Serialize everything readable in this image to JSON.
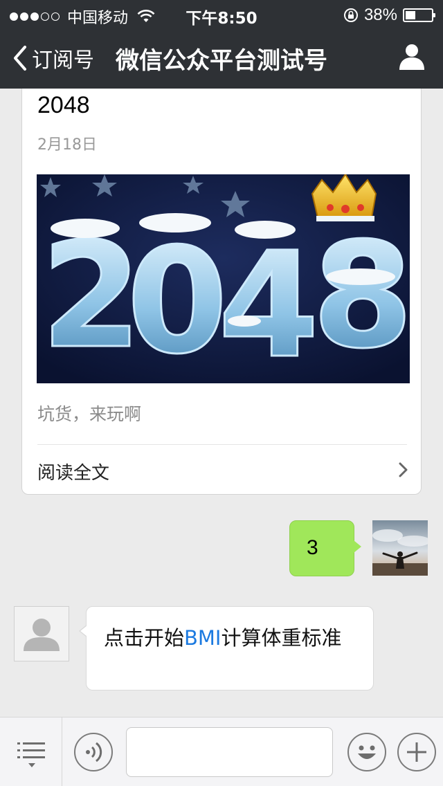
{
  "status_bar": {
    "carrier": "中国移动",
    "time": "下午8:50",
    "battery": "38%",
    "battery_level": 0.38
  },
  "nav": {
    "back_label": "订阅号",
    "title": "微信公众平台测试号"
  },
  "article": {
    "title": "2048",
    "date": "2月18日",
    "cover_text": "2048",
    "digest": "坑货，来玩啊",
    "read_more": "阅读全文"
  },
  "messages": {
    "outgoing_text": "3",
    "incoming_prefix": "点击开始",
    "incoming_link": "BMI",
    "incoming_suffix": "计算体重标准"
  },
  "input_bar": {
    "value": "",
    "placeholder": ""
  },
  "colors": {
    "nav_bg": "#2e3135",
    "chat_bg": "#ebebeb",
    "outgoing_bubble": "#a0e75a",
    "link": "#1c7ae0"
  },
  "icons": {
    "back": "chevron-left-icon",
    "profile": "person-icon",
    "read_more": "chevron-right-icon",
    "menu": "list-menu-icon",
    "voice": "voice-icon",
    "emoji": "smiley-icon",
    "plus": "plus-icon"
  }
}
